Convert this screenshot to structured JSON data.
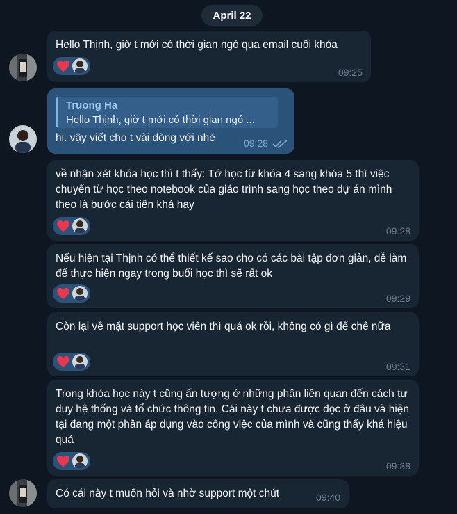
{
  "date_label": "April 22",
  "outgoing": {
    "reply": {
      "name": "Truong Ha",
      "text": "Hello Thịnh, giờ t mới có thời gian ngó ..."
    },
    "text": "hi. vậy viết cho t vài dòng với nhé",
    "time": "09:28",
    "status": "read"
  },
  "messages": [
    {
      "text": "Hello Thịnh, giờ t mới có thời gian ngó qua email cuối khóa",
      "time": "09:25",
      "reaction": "heart"
    },
    {
      "text": "về nhận xét khóa học thì t thấy: Tớ học từ khóa 4 sang khóa 5 thì việc chuyển từ học theo notebook của giáo trình sang học theo dự án mình theo là bước cải tiến khá hay",
      "time": "09:28",
      "reaction": "heart"
    },
    {
      "text": "Nếu hiện tại Thịnh có thể thiết kế sao cho có các bài tập đơn giản, dễ làm để thực hiện ngay trong buổi học thì sẽ rất ok",
      "time": "09:29",
      "reaction": "heart"
    },
    {
      "text": "Còn lại về mặt support học viên thì quá ok rồi, không có gì để chê nữa",
      "time": "09:31",
      "reaction": "heart"
    },
    {
      "text": "Trong khóa học này t cũng ấn tượng ở những phần liên quan đến cách tư duy hệ thống và tổ chức thông tin. Cái này t chưa được đọc ở đâu và hiện tại đang một phần áp dụng vào công việc của mình và cũng thấy khá hiệu quả",
      "time": "09:38",
      "reaction": "heart"
    },
    {
      "text": "Có cái này t muốn hỏi và nhờ support một chút",
      "time": "09:40"
    }
  ],
  "colors": {
    "background": "#0e1621",
    "incoming_bubble": "#182533",
    "outgoing_bubble": "#2b5278",
    "reaction_heart": "#e8384f"
  }
}
